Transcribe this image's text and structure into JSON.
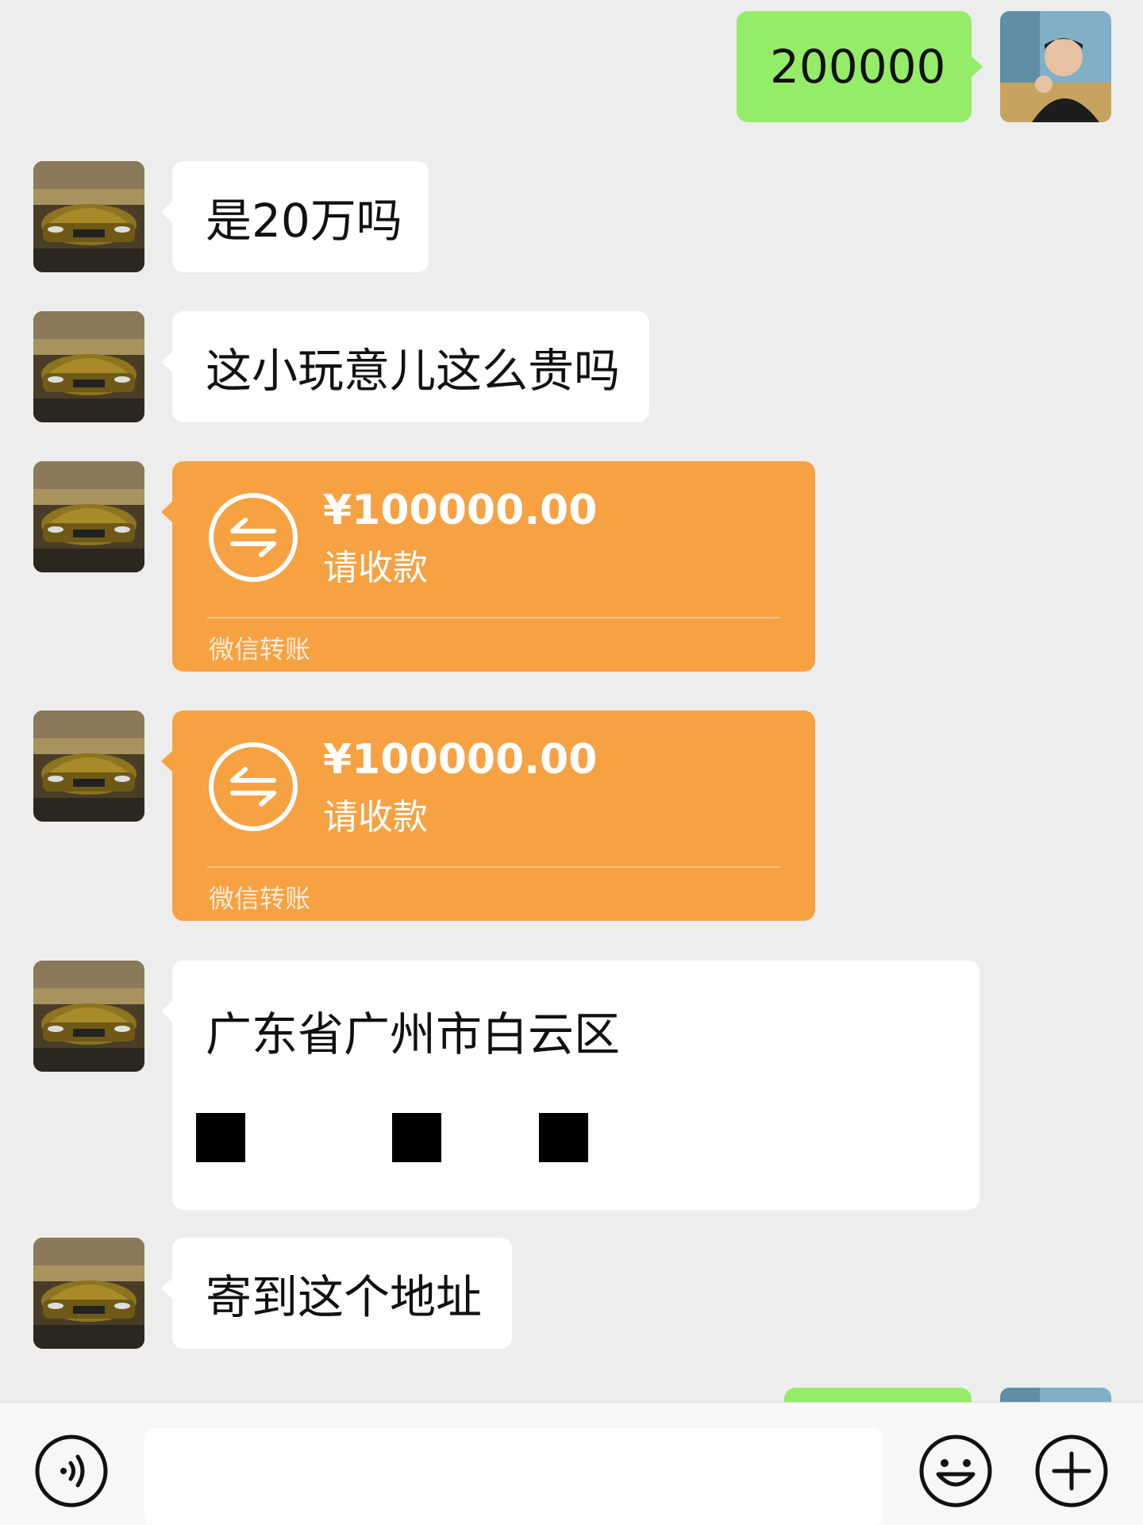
{
  "messages": {
    "m1_text": "200000",
    "m2_text": "是20万吗",
    "m3_text": "这小玩意儿这么贵吗",
    "m6_address": "广东省广州市白云区",
    "m7_text": "寄到这个地址"
  },
  "transfers": [
    {
      "amount": "¥100000.00",
      "status": "请收款",
      "footer": "微信转账"
    },
    {
      "amount": "¥100000.00",
      "status": "请收款",
      "footer": "微信转账"
    }
  ],
  "icons": {
    "voice": "voice-icon",
    "emoji": "emoji-icon",
    "plus": "plus-icon",
    "transfer": "transfer-icon"
  },
  "colors": {
    "background": "#ededed",
    "self_bubble": "#95ec69",
    "other_bubble": "#ffffff",
    "transfer_card": "#f6a243"
  }
}
